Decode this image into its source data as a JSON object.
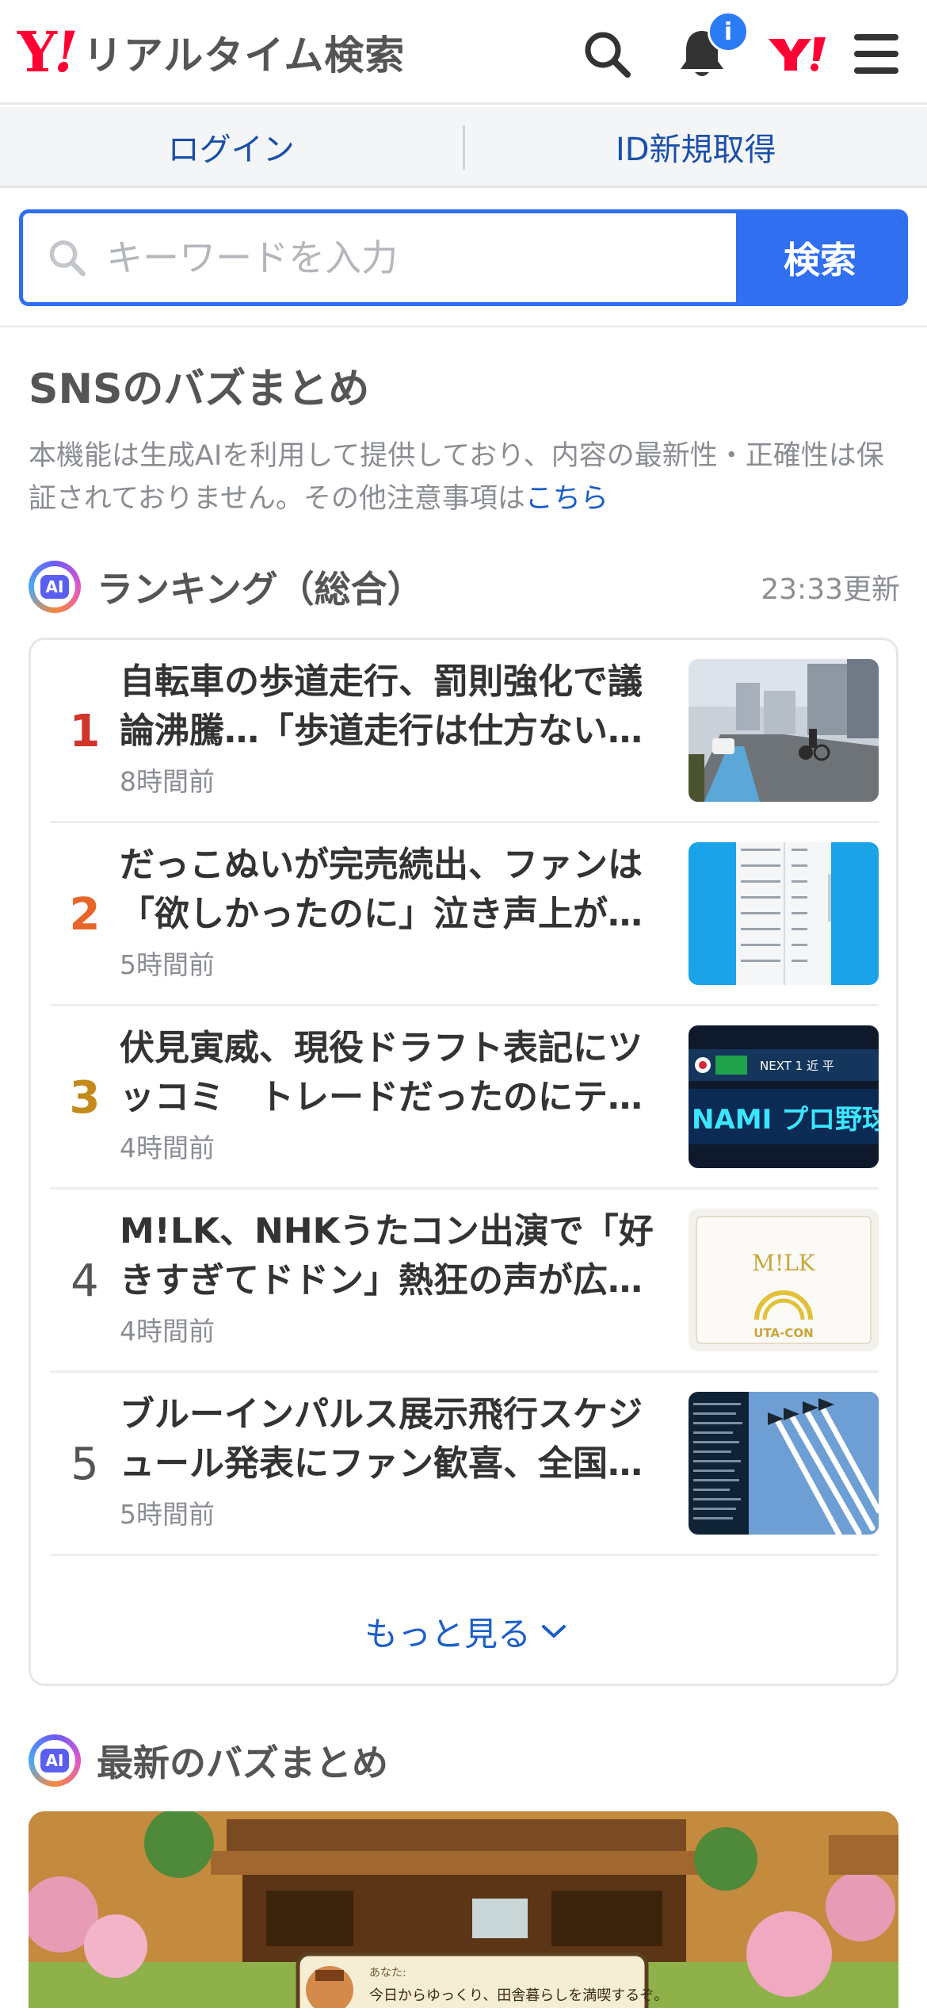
{
  "header": {
    "logo_y": "Y",
    "logo_bang": "!",
    "title": "リアルタイム検索",
    "notification_badge": "i",
    "icons": [
      "search-icon",
      "bell-icon",
      "yahoo-logo-icon",
      "menu-icon"
    ]
  },
  "auth": {
    "login": "ログイン",
    "signup": "ID新規取得"
  },
  "search": {
    "placeholder": "キーワードを入力",
    "button": "検索"
  },
  "section": {
    "title": "SNSのバズまとめ",
    "note": "本機能は生成AIを利用して提供しており、内容の最新性・正確性は保証されておりません。その他注意事項は",
    "note_link": "こちら"
  },
  "ranking": {
    "ai_label": "AI",
    "label": "ランキング（総合）",
    "updated": "23:33更新",
    "items": [
      {
        "rank": "1",
        "headline": "自転車の歩道走行、罰則強化で議論沸騰…「歩道走行は仕方ない…",
        "time": "8時間前",
        "rank_color": "#d0352c"
      },
      {
        "rank": "2",
        "headline": "だっこぬいが完売続出、ファンは「欲しかったのに」泣き声上が…",
        "time": "5時間前",
        "rank_color": "#e8652a"
      },
      {
        "rank": "3",
        "headline": "伏見寅威、現役ドラフト表記にツッコミ　トレードだったのにテ…",
        "time": "4時間前",
        "rank_color": "#c48a1c"
      },
      {
        "rank": "4",
        "headline": "M!LK、NHKうたコン出演で「好きすぎてドドン」熱狂の声が広…",
        "time": "4時間前",
        "rank_color": "#555555"
      },
      {
        "rank": "5",
        "headline": "ブルーインパルス展示飛行スケジュール発表にファン歓喜、全国…",
        "time": "5時間前",
        "rank_color": "#555555"
      }
    ],
    "more": "もっと見る"
  },
  "thumb_text": {
    "t3_line1": "NEXT 1  近 平",
    "t3_line2": "NAMI プロ野球ス",
    "t4_logo": "M!LK",
    "t4_sub": "UTA-CON"
  },
  "latest": {
    "ai_label": "AI",
    "label": "最新のバズまとめ",
    "banner_speaker": "あなた:",
    "banner_text": "今日からゆっくり、田舎暮らしを満喫するぞ。"
  }
}
